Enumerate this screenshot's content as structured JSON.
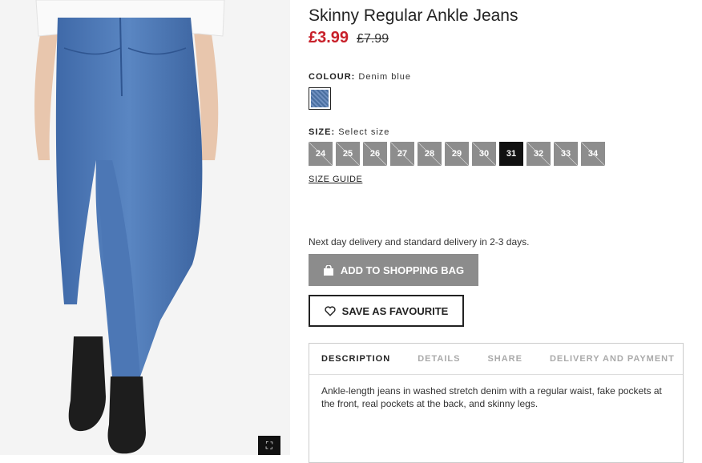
{
  "product": {
    "title": "Skinny Regular Ankle Jeans",
    "price_now": "£3.99",
    "price_was": "£7.99"
  },
  "colour": {
    "label": "COLOUR:",
    "value": "Denim blue",
    "swatch_color": "#5a7fb3"
  },
  "size": {
    "label": "SIZE:",
    "value": "Select size",
    "options": [
      {
        "label": "24",
        "available": false
      },
      {
        "label": "25",
        "available": false
      },
      {
        "label": "26",
        "available": false
      },
      {
        "label": "27",
        "available": false
      },
      {
        "label": "28",
        "available": false
      },
      {
        "label": "29",
        "available": false
      },
      {
        "label": "30",
        "available": false
      },
      {
        "label": "31",
        "available": true,
        "selected": true
      },
      {
        "label": "32",
        "available": false
      },
      {
        "label": "33",
        "available": false
      },
      {
        "label": "34",
        "available": false
      }
    ],
    "guide_label": "SIZE GUIDE"
  },
  "delivery_text": "Next day delivery and standard delivery in 2-3 days.",
  "buttons": {
    "add_to_bag": "ADD TO SHOPPING BAG",
    "save_favourite": "SAVE AS FAVOURITE"
  },
  "tabs": [
    {
      "label": "DESCRIPTION",
      "active": true
    },
    {
      "label": "DETAILS",
      "active": false
    },
    {
      "label": "SHARE",
      "active": false
    },
    {
      "label": "DELIVERY AND PAYMENT",
      "active": false
    }
  ],
  "description": "Ankle-length jeans in washed stretch denim with a regular waist, fake pockets at the front, real pockets at the back, and skinny legs.",
  "colors": {
    "sale_red": "#c8202a",
    "button_grey": "#8c8c8c",
    "selected_size": "#111111"
  }
}
